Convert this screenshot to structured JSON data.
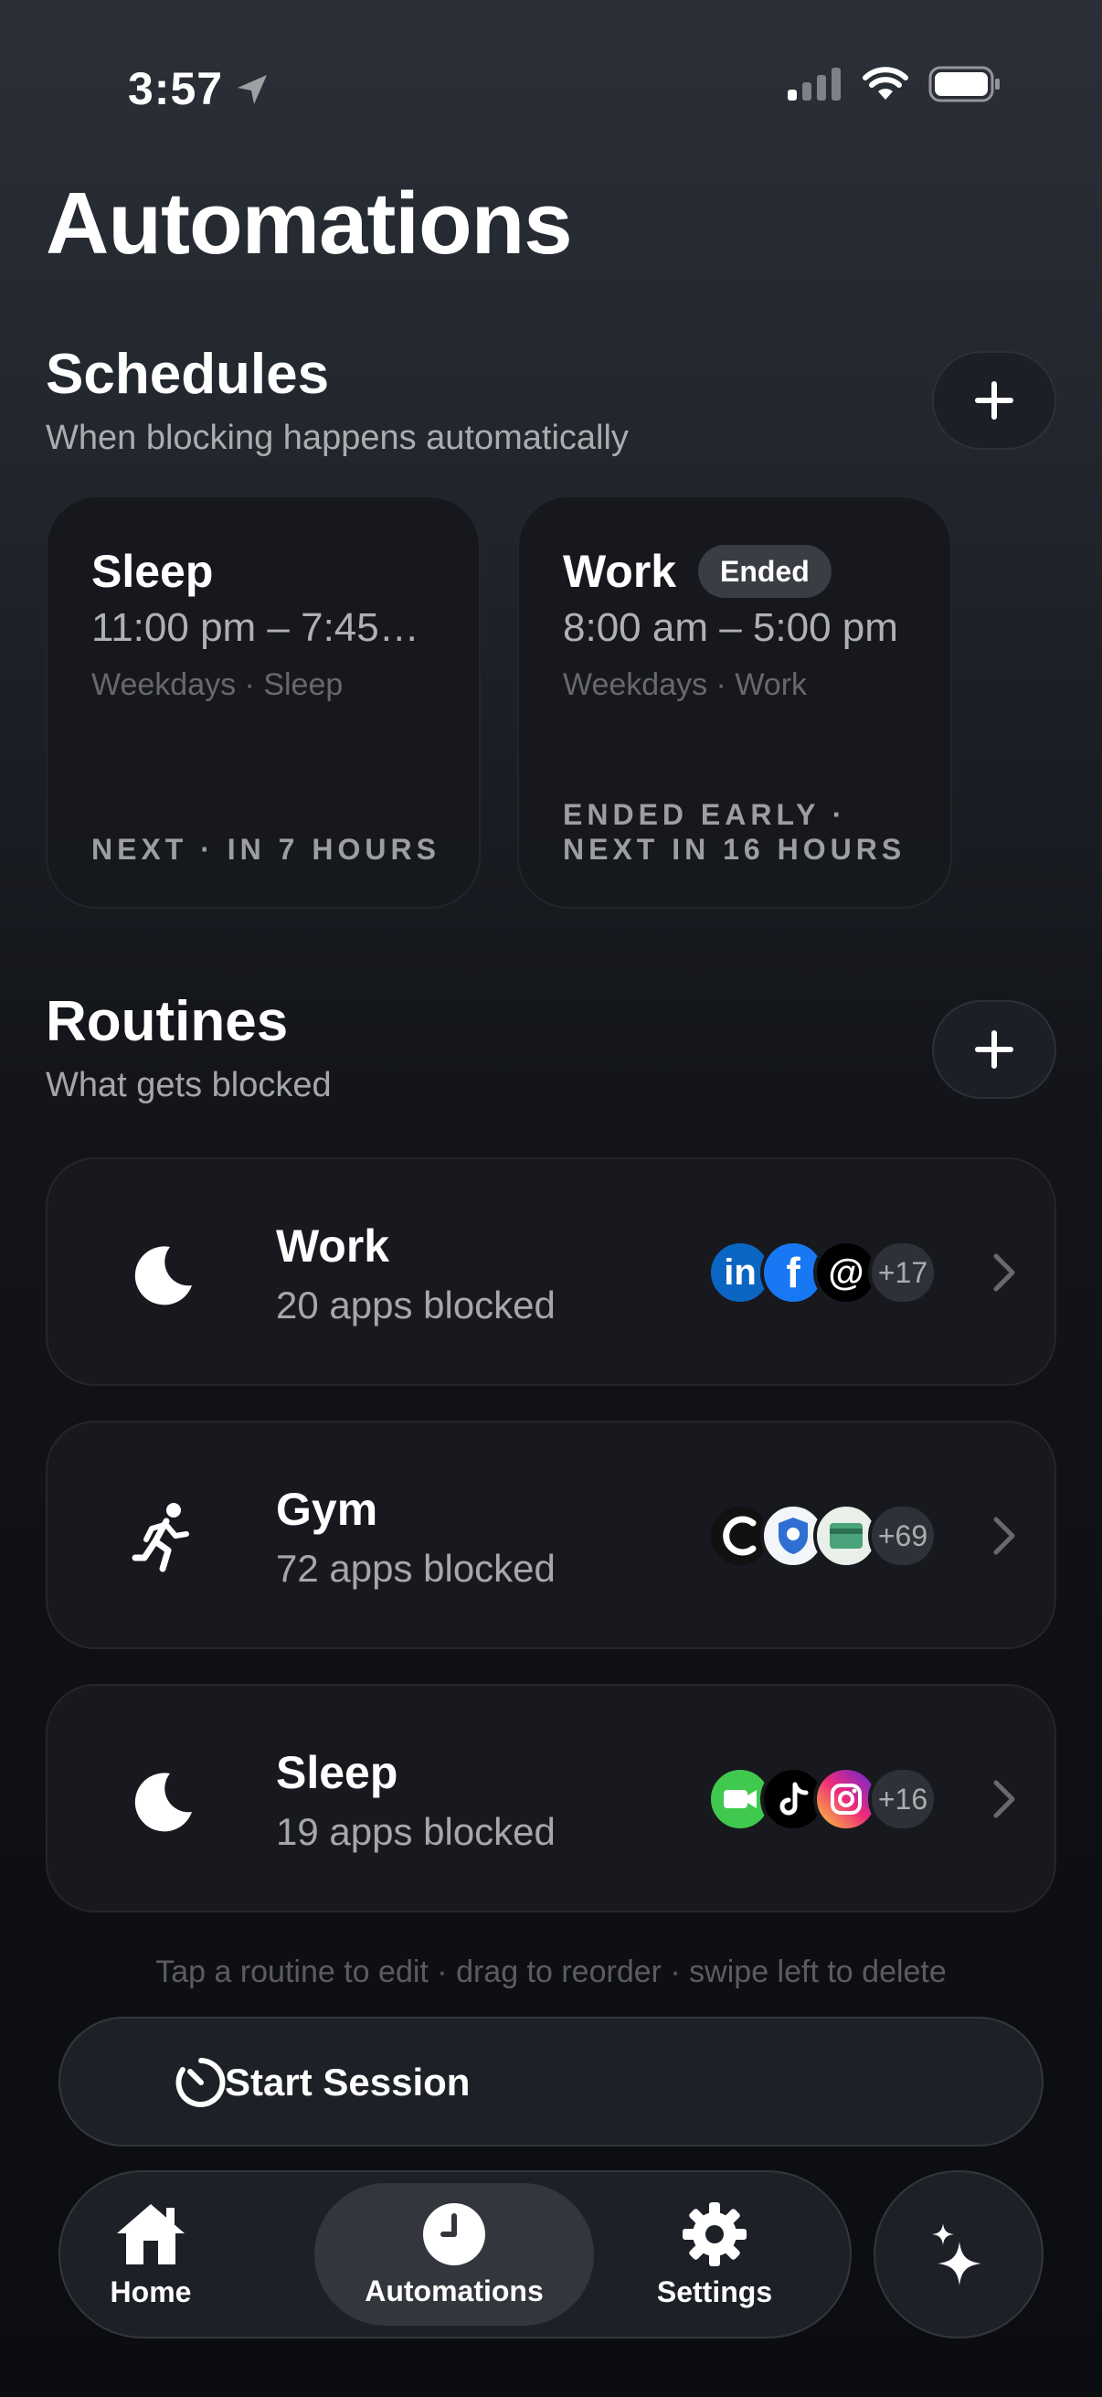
{
  "status_bar": {
    "time": "3:57"
  },
  "page": {
    "title": "Automations"
  },
  "schedules": {
    "title": "Schedules",
    "subtitle": "When blocking happens automatically",
    "items": [
      {
        "name": "Sleep",
        "time": "11:00 pm – 7:45…",
        "days": "Weekdays · Sleep",
        "footer_line1": "NEXT · IN 7 HOURS",
        "footer_line2": "",
        "badge": ""
      },
      {
        "name": "Work",
        "time": "8:00 am – 5:00 pm",
        "days": "Weekdays · Work",
        "footer_line1": "ENDED EARLY ·",
        "footer_line2": "NEXT IN 16 HOURS",
        "badge": "Ended"
      }
    ]
  },
  "routines": {
    "title": "Routines",
    "subtitle": "What gets blocked",
    "items": [
      {
        "name": "Work",
        "count": "20 apps blocked",
        "icon": "moon-icon",
        "apps": [
          "linkedin-icon",
          "facebook-icon",
          "threads-icon"
        ],
        "more": "+17"
      },
      {
        "name": "Gym",
        "count": "72 apps blocked",
        "icon": "running-icon",
        "apps": [
          "app-c-icon",
          "app-shield-icon",
          "app-card-icon"
        ],
        "more": "+69"
      },
      {
        "name": "Sleep",
        "count": "19 apps blocked",
        "icon": "moon-icon",
        "apps": [
          "facetime-icon",
          "tiktok-icon",
          "instagram-icon"
        ],
        "more": "+16"
      }
    ],
    "hint": "Tap a routine to edit · drag to reorder · swipe left to delete"
  },
  "session": {
    "label": "Start Session"
  },
  "tabs": [
    {
      "label": "Home",
      "icon": "house-icon"
    },
    {
      "label": "Automations",
      "icon": "clock-icon",
      "active": true
    },
    {
      "label": "Settings",
      "icon": "gear-icon"
    }
  ],
  "colors": {
    "background_top": "#2b2f37",
    "background_bottom": "#0c0d11",
    "card": "#17191e",
    "badge": "#3a3d44"
  }
}
